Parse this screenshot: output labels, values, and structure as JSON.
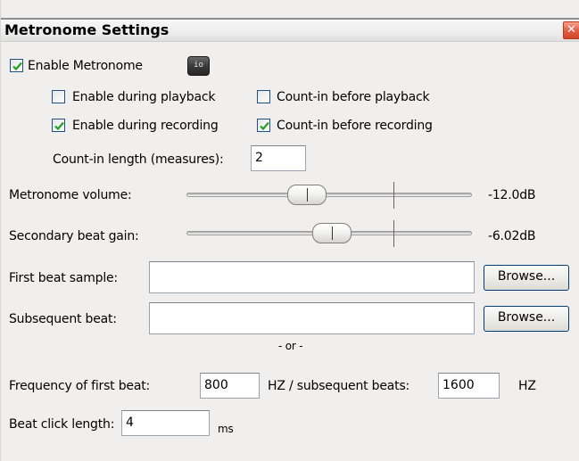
{
  "dialog": {
    "title": "Metronome Settings",
    "close_symbol": "✕"
  },
  "enable": {
    "label": "Enable Metronome",
    "checked": true,
    "io_button_label": "io"
  },
  "options": {
    "enable_during_playback": {
      "label": "Enable during playback",
      "checked": false
    },
    "count_in_before_playback": {
      "label": "Count-in before playback",
      "checked": false
    },
    "enable_during_recording": {
      "label": "Enable during recording",
      "checked": true
    },
    "count_in_before_recording": {
      "label": "Count-in before recording",
      "checked": true
    }
  },
  "count_in": {
    "label": "Count-in length (measures):",
    "value": "2"
  },
  "metronome_volume": {
    "label": "Metronome volume:",
    "value_text": "-12.0dB",
    "position": 0.422
  },
  "secondary_gain": {
    "label": "Secondary beat gain:",
    "value_text": "-6.02dB",
    "position": 0.51
  },
  "first_beat_sample": {
    "label": "First beat sample:",
    "value": "",
    "browse_label": "Browse..."
  },
  "subsequent_beat": {
    "label": "Subsequent beat:",
    "value": "",
    "browse_label": "Browse..."
  },
  "or_text": "- or -",
  "frequency": {
    "first_label": "Frequency of first beat:",
    "first_value": "800",
    "subsequent_label": "HZ / subsequent beats:",
    "subsequent_value": "1600",
    "unit": "HZ"
  },
  "click_length": {
    "label": "Beat click length:",
    "value": "4",
    "unit": "ms"
  },
  "colors": {
    "title_close": "#e25a3f",
    "dialog_background": "#f0efee",
    "check_border": "#1c5180",
    "check_mark": "#21a121"
  }
}
